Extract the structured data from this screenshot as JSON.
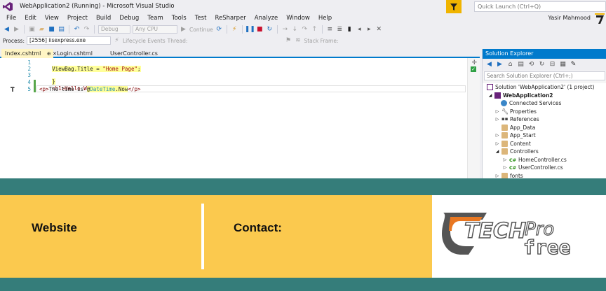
{
  "window": {
    "title": "WebApplication2 (Running) - Microsoft Visual Studio",
    "quick_launch_placeholder": "Quick Launch (Ctrl+Q)",
    "user_name": "Yasir Mahmood"
  },
  "menu": [
    "File",
    "Edit",
    "View",
    "Project",
    "Build",
    "Debug",
    "Team",
    "Tools",
    "Test",
    "ReSharper",
    "Analyze",
    "Window",
    "Help"
  ],
  "toolbar": {
    "config": "Debug",
    "platform": "Any CPU",
    "continue_label": "Continue",
    "process_label": "Process:",
    "process_value": "[2556] iisexpress.exe",
    "lifecycle_label": "Lifecycle Events",
    "thread_label": "Thread:",
    "stack_frame_label": "Stack Frame:"
  },
  "tabs": [
    {
      "label": "Index.cshtml",
      "pin": "⊕ ✕"
    },
    {
      "label": "Login.cshtml"
    },
    {
      "label": "UserController.cs"
    }
  ],
  "editor": {
    "line_numbers": [
      "1",
      "2",
      "3",
      "4",
      "5"
    ],
    "lines": [
      {
        "razor": "@{"
      },
      {
        "indent": "    ",
        "code": "ViewBag.Title = ",
        "str": "\"Home Page\"",
        "tail": ";"
      },
      {
        "razor": "}"
      },
      {
        "tag": "<h1>Hello Web Pages</h1>"
      },
      {
        "open": "<p>",
        "text": "The time is ",
        "razor": "@",
        "type": "DateTime",
        "after": ".Now",
        "close": "</p>"
      }
    ]
  },
  "solution_explorer": {
    "title": "Solution Explorer",
    "search_placeholder": "Search Solution Explorer (Ctrl+;)",
    "items": [
      {
        "label": "Solution 'WebApplication2' (1 project)"
      },
      {
        "label": "WebApplication2"
      },
      {
        "label": "Connected Services"
      },
      {
        "label": "Properties"
      },
      {
        "label": "References"
      },
      {
        "label": "App_Data"
      },
      {
        "label": "App_Start"
      },
      {
        "label": "Content"
      },
      {
        "label": "Controllers"
      },
      {
        "label": "HomeController.cs",
        "glyph": "C#"
      },
      {
        "label": "UserController.cs",
        "glyph": "C#"
      },
      {
        "label": "fonts"
      }
    ]
  },
  "banner": {
    "website_label": "Website",
    "contact_label": "Contact:",
    "logo_text_1": "TECH",
    "logo_text_2": "Pro",
    "logo_text_3": "free"
  },
  "colors": {
    "accent": "#007acc",
    "teal": "#357d7a",
    "banner_yellow": "#fbc94e",
    "run_orange": "#f0b400"
  }
}
